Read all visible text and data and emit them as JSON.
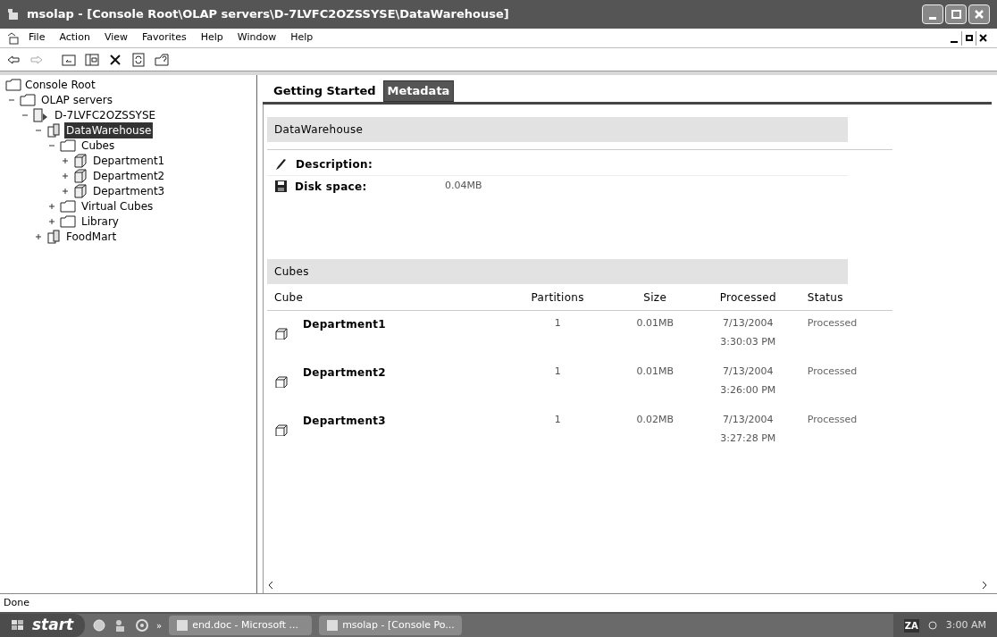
{
  "window": {
    "title": "msolap - [Console Root\\OLAP servers\\D-7LVFC2OZSSYSE\\DataWarehouse]"
  },
  "menu": [
    "File",
    "Action",
    "View",
    "Favorites",
    "Help",
    "Window",
    "Help"
  ],
  "tree": {
    "root": "Console Root",
    "items": [
      {
        "label": "OLAP servers",
        "kind": "folder",
        "expanded": true,
        "selected": false,
        "children": [
          {
            "label": "D-7LVFC2OZSSYSE",
            "kind": "server",
            "expanded": true,
            "selected": false,
            "children": [
              {
                "label": "DataWarehouse",
                "kind": "database",
                "expanded": true,
                "selected": true,
                "children": [
                  {
                    "label": "Cubes",
                    "kind": "folder",
                    "expanded": true,
                    "selected": false,
                    "children": [
                      {
                        "label": "Department1",
                        "kind": "cube",
                        "expanded": false,
                        "selected": false
                      },
                      {
                        "label": "Department2",
                        "kind": "cube",
                        "expanded": false,
                        "selected": false
                      },
                      {
                        "label": "Department3",
                        "kind": "cube",
                        "expanded": false,
                        "selected": false
                      }
                    ]
                  },
                  {
                    "label": "Virtual Cubes",
                    "kind": "folder",
                    "expanded": false,
                    "selected": false
                  },
                  {
                    "label": "Library",
                    "kind": "folder",
                    "expanded": false,
                    "selected": false
                  }
                ]
              },
              {
                "label": "FoodMart",
                "kind": "database",
                "expanded": false,
                "selected": false
              }
            ]
          }
        ]
      }
    ]
  },
  "tabs": [
    {
      "label": "Getting Started",
      "selected": false
    },
    {
      "label": "Metadata",
      "selected": true
    }
  ],
  "database": {
    "name": "DataWarehouse",
    "description_label": "Description:",
    "disk_label": "Disk space:",
    "disk_value": "0.04MB"
  },
  "cubes": {
    "title": "Cubes",
    "columns": [
      "Cube",
      "Partitions",
      "Size",
      "Processed",
      "Status"
    ],
    "rows": [
      {
        "name": "Department1",
        "partitions": "1",
        "size": "0.01MB",
        "date": "7/13/2004",
        "time": "3:30:03 PM",
        "status": "Processed"
      },
      {
        "name": "Department2",
        "partitions": "1",
        "size": "0.01MB",
        "date": "7/13/2004",
        "time": "3:26:00 PM",
        "status": "Processed"
      },
      {
        "name": "Department3",
        "partitions": "1",
        "size": "0.02MB",
        "date": "7/13/2004",
        "time": "3:27:28 PM",
        "status": "Processed"
      }
    ]
  },
  "status_bar": "Done",
  "taskbar": {
    "start": "start",
    "more": "»",
    "tasks": [
      "end.doc - Microsoft ...",
      "msolap - [Console Po..."
    ],
    "tray_lang": "ZA",
    "clock": "3:00 AM"
  }
}
